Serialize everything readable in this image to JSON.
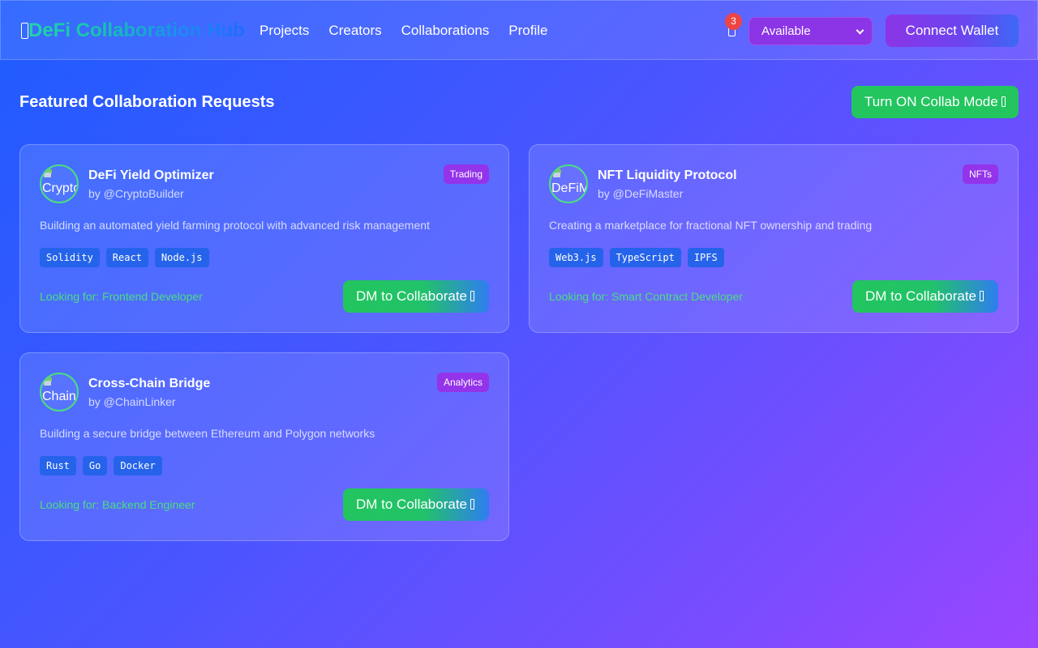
{
  "header": {
    "logo": "DeFi Collaboration Hub",
    "logo_icon": "missing-glyph-icon",
    "nav": [
      "Projects",
      "Creators",
      "Collaborations",
      "Profile"
    ],
    "notifications": {
      "icon": "bell-icon",
      "count": "3"
    },
    "status_select": {
      "value": "Available"
    },
    "connect_wallet": "Connect Wallet"
  },
  "main": {
    "section_title": "Featured Collaboration Requests",
    "collab_mode_button": "Turn ON Collab Mode",
    "cards": [
      {
        "title": "DeFi Yield Optimizer",
        "author": "by @CryptoBuilder",
        "avatar_alt": "CryptoBuilder",
        "category": "Trading",
        "description": "Building an automated yield farming protocol with advanced risk management",
        "tags": [
          "Solidity",
          "React",
          "Node.js"
        ],
        "looking_for": "Looking for: Frontend Developer",
        "dm_button": "DM to Collaborate"
      },
      {
        "title": "NFT Liquidity Protocol",
        "author": "by @DeFiMaster",
        "avatar_alt": "DeFiMaster",
        "category": "NFTs",
        "description": "Creating a marketplace for fractional NFT ownership and trading",
        "tags": [
          "Web3.js",
          "TypeScript",
          "IPFS"
        ],
        "looking_for": "Looking for: Smart Contract Developer",
        "dm_button": "DM to Collaborate"
      },
      {
        "title": "Cross-Chain Bridge",
        "author": "by @ChainLinker",
        "avatar_alt": "ChainLinker",
        "category": "Analytics",
        "description": "Building a secure bridge between Ethereum and Polygon networks",
        "tags": [
          "Rust",
          "Go",
          "Docker"
        ],
        "looking_for": "Looking for: Backend Engineer",
        "dm_button": "DM to Collaborate"
      }
    ]
  },
  "colors": {
    "accent_green": "#22c55e",
    "accent_purple": "#9333ea",
    "tag_blue": "#2563eb",
    "badge_red": "#ef4444",
    "looking_for_green": "#4ade80"
  }
}
